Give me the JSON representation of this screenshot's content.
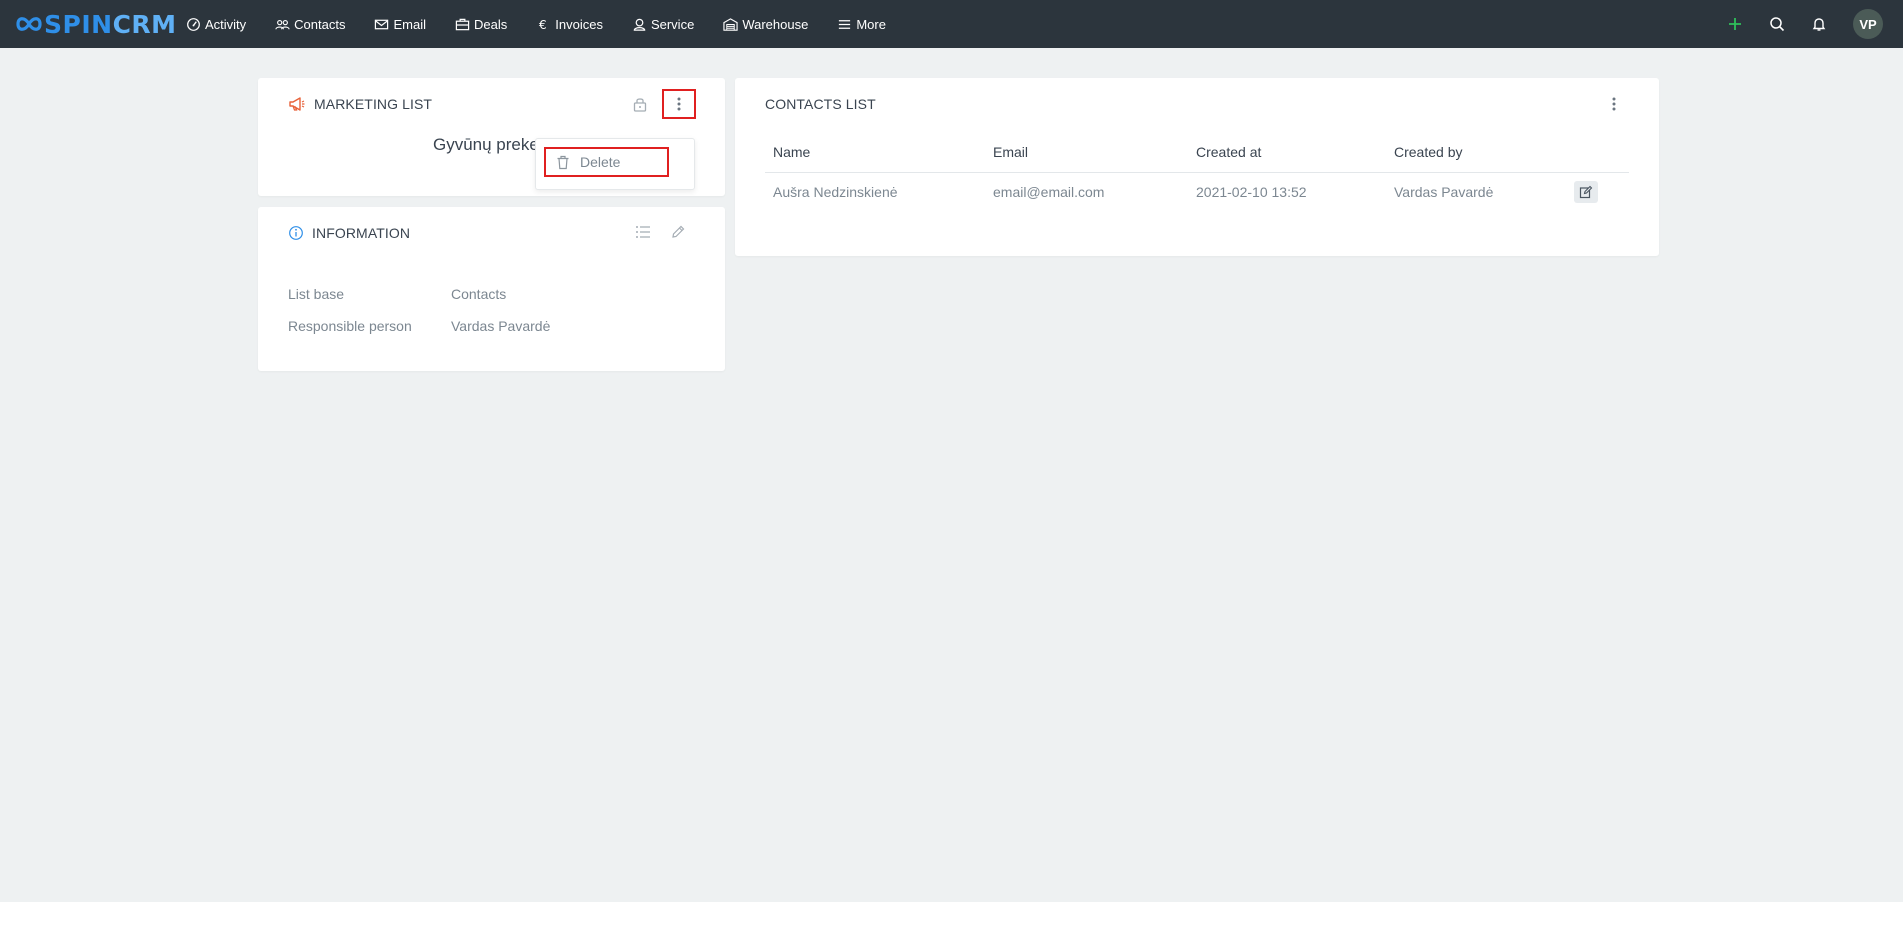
{
  "app": {
    "logo_spin": "SPIN",
    "logo_crm": "CRM",
    "brand_color": "#2f8fe8"
  },
  "nav": {
    "items": [
      {
        "label": "Activity",
        "icon": "gauge-icon"
      },
      {
        "label": "Contacts",
        "icon": "people-icon"
      },
      {
        "label": "Email",
        "icon": "envelope-icon"
      },
      {
        "label": "Deals",
        "icon": "briefcase-icon"
      },
      {
        "label": "Invoices",
        "icon": "euro-icon"
      },
      {
        "label": "Service",
        "icon": "headset-icon"
      },
      {
        "label": "Warehouse",
        "icon": "warehouse-icon"
      },
      {
        "label": "More",
        "icon": "hamburger-icon"
      }
    ]
  },
  "topright": {
    "add_icon": "plus-icon",
    "search_icon": "search-icon",
    "bell_icon": "bell-icon",
    "avatar_initials": "VP",
    "add_color": "#2ec05a"
  },
  "marketing_card": {
    "header": "MARKETING LIST",
    "title": "Gyvūnų preke",
    "accent_color": "#e8623a"
  },
  "dropdown": {
    "items": [
      {
        "label": "Delete",
        "icon": "trash-icon"
      }
    ]
  },
  "info_card": {
    "header": "INFORMATION",
    "rows": [
      {
        "key": "List base",
        "value": "Contacts"
      },
      {
        "key": "Responsible person",
        "value": "Vardas Pavardė"
      }
    ],
    "accent_color": "#2f8fe8"
  },
  "contacts_card": {
    "header": "CONTACTS LIST",
    "columns": [
      "Name",
      "Email",
      "Created at",
      "Created by"
    ],
    "rows": [
      {
        "name": "Aušra Nedzinskienė",
        "email": "email@email.com",
        "created_at": "2021-02-10 13:52",
        "created_by": "Vardas Pavardė"
      }
    ]
  }
}
